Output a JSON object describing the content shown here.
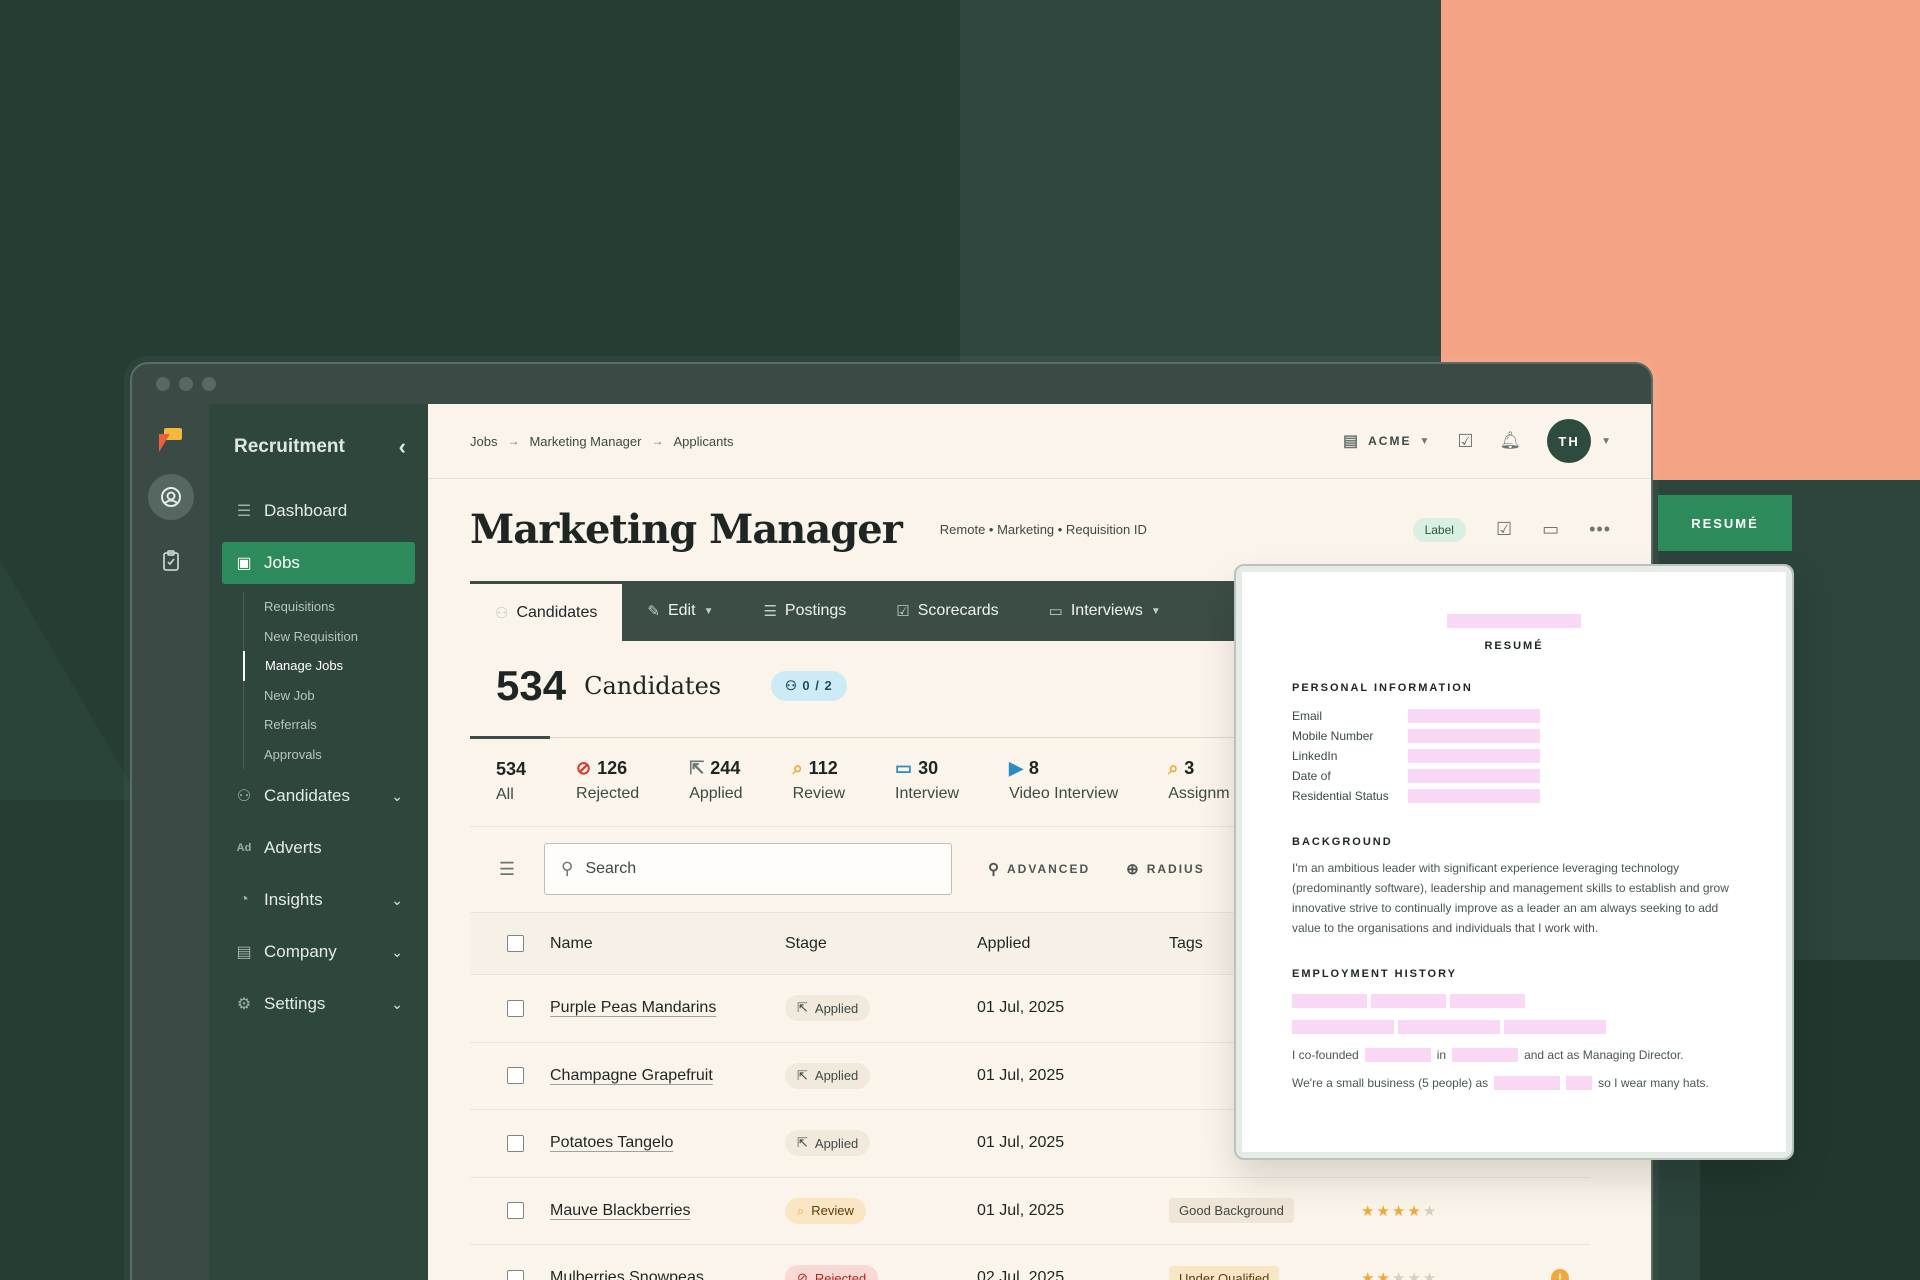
{
  "sidebar": {
    "title": "Recruitment",
    "items": [
      {
        "label": "Dashboard",
        "icon": "dashboard-icon"
      },
      {
        "label": "Jobs",
        "icon": "briefcase-icon"
      },
      {
        "label": "Candidates",
        "icon": "users-icon"
      },
      {
        "label": "Adverts",
        "icon": "ad-icon"
      },
      {
        "label": "Insights",
        "icon": "pie-chart-icon"
      },
      {
        "label": "Company",
        "icon": "building-icon"
      },
      {
        "label": "Settings",
        "icon": "gear-icon"
      }
    ],
    "jobs_sub": [
      "Requisitions",
      "New Requisition",
      "Manage Jobs",
      "New Job",
      "Referrals",
      "Approvals"
    ],
    "adverts_badge": "Ad"
  },
  "breadcrumb": [
    "Jobs",
    "Marketing Manager",
    "Applicants"
  ],
  "topbar": {
    "org": "ACME",
    "avatar_initials": "TH"
  },
  "job": {
    "title": "Marketing Manager",
    "meta": "Remote • Marketing • Requisition ID",
    "label_chip": "Label"
  },
  "tabs": [
    {
      "label": "Candidates"
    },
    {
      "label": "Edit"
    },
    {
      "label": "Postings"
    },
    {
      "label": "Scorecards"
    },
    {
      "label": "Interviews"
    }
  ],
  "candidates_count": {
    "number": "534",
    "label": "Candidates",
    "team": "0 / 2"
  },
  "stages": [
    {
      "num": "534",
      "label": "All"
    },
    {
      "num": "126",
      "label": "Rejected"
    },
    {
      "num": "244",
      "label": "Applied"
    },
    {
      "num": "112",
      "label": "Review"
    },
    {
      "num": "30",
      "label": "Interview"
    },
    {
      "num": "8",
      "label": "Video Interview"
    },
    {
      "num": "3",
      "label": "Assignm"
    }
  ],
  "search": {
    "placeholder": "Search",
    "advanced": "ADVANCED",
    "radius": "RADIUS"
  },
  "table": {
    "headers": [
      "Name",
      "Stage",
      "Applied",
      "Tags"
    ],
    "rows": [
      {
        "name": "Purple Peas Mandarins",
        "stage": "Applied",
        "applied": "01 Jul, 2025",
        "tag": "",
        "rating": 0
      },
      {
        "name": "Champagne Grapefruit",
        "stage": "Applied",
        "applied": "01 Jul, 2025",
        "tag": "",
        "rating": 0
      },
      {
        "name": "Potatoes Tangelo",
        "stage": "Applied",
        "applied": "01 Jul, 2025",
        "tag": "",
        "rating": 0
      },
      {
        "name": "Mauve Blackberries",
        "stage": "Review",
        "applied": "01 Jul, 2025",
        "tag": "Good Background",
        "rating": 4.5
      },
      {
        "name": "Mulberries Snowpeas",
        "stage": "Rejected",
        "applied": "02 Jul, 2025",
        "tag": "Under Qualified",
        "rating": 2
      }
    ]
  },
  "resume": {
    "button": "RESUMÉ",
    "title": "RESUMÉ",
    "personal_heading": "PERSONAL INFORMATION",
    "fields": [
      "Email",
      "Mobile Number",
      "LinkedIn",
      "Date of",
      "Residential Status"
    ],
    "background_heading": "BACKGROUND",
    "background_text": "I'm an ambitious leader with significant experience leveraging technology (predominantly software), leadership and management skills to establish and grow innovative strive to continually improve as a leader an am always seeking to add value to the organisations and individuals that I work with.",
    "employment_heading": "EMPLOYMENT HISTORY",
    "line1_a": "I co-founded",
    "line1_b": "in",
    "line1_c": "and act as Managing Director.",
    "line2_a": "We're a small business (5 people) as",
    "line2_b": "so I wear many hats."
  },
  "colors": {
    "accent": "#2d8a5a",
    "salmon": "#f4a384",
    "dark": "#253d33",
    "cream": "#fbf4ea"
  }
}
